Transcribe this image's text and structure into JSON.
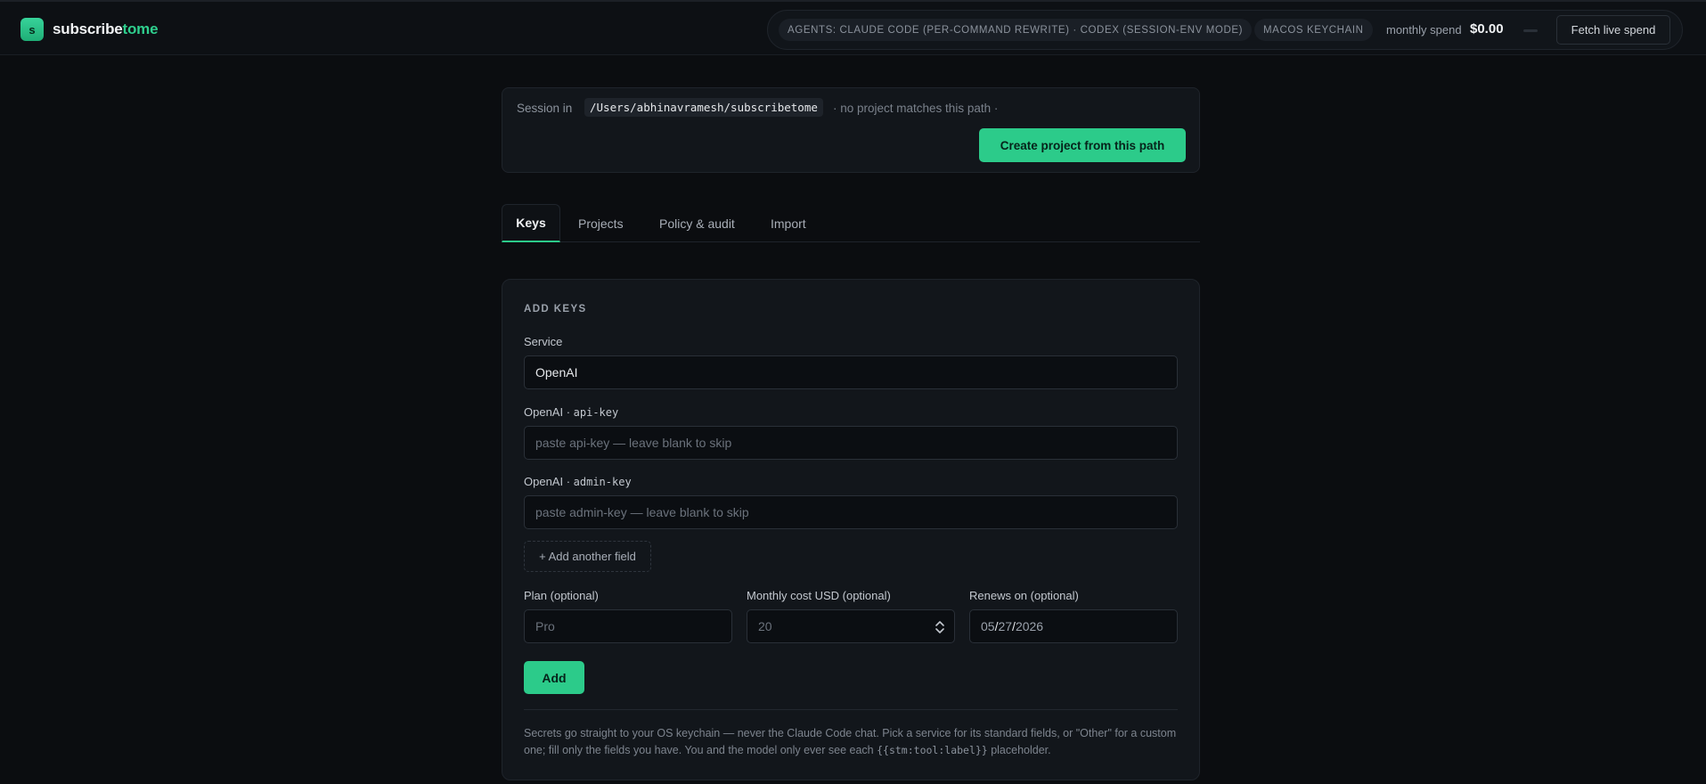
{
  "header": {
    "logo_letter": "s",
    "brand_main": "subscribe",
    "brand_accent": "tome",
    "agents_chip": "AGENTS: CLAUDE CODE (PER-COMMAND REWRITE) · CODEX (SESSION-ENV MODE)",
    "keychain_chip": "MACOS KEYCHAIN",
    "spend_label": "monthly spend",
    "spend_value": "$0.00",
    "fetch_button": "Fetch live spend"
  },
  "session": {
    "label": "Session in",
    "path": "/Users/abhinavramesh/subscribetome",
    "note": "· no project matches this path ·",
    "create_button": "Create project from this path"
  },
  "tabs": [
    {
      "label": "Keys",
      "active": true
    },
    {
      "label": "Projects",
      "active": false
    },
    {
      "label": "Policy & audit",
      "active": false
    },
    {
      "label": "Import",
      "active": false
    }
  ],
  "add_keys": {
    "title": "ADD KEYS",
    "service_label": "Service",
    "service_value": "OpenAI",
    "api_key_label_prefix": "OpenAI · ",
    "api_key_label_code": "api-key",
    "api_key_placeholder": "paste api-key — leave blank to skip",
    "admin_key_label_prefix": "OpenAI · ",
    "admin_key_label_code": "admin-key",
    "admin_key_placeholder": "paste admin-key — leave blank to skip",
    "add_field_button": "+ Add another field",
    "plan_label": "Plan (optional)",
    "plan_placeholder": "Pro",
    "cost_label": "Monthly cost USD (optional)",
    "cost_placeholder": "20",
    "renews_label": "Renews on (optional)",
    "renews_month": "05",
    "renews_day": "27",
    "renews_year": "2026",
    "date_separator": "/",
    "add_button": "Add",
    "footnote_text": "Secrets go straight to your OS keychain — never the Claude Code chat. Pick a service for its standard fields, or \"Other\" for a custom one; fill only the fields you have. You and the model only ever see each ",
    "footnote_code": "{{stm:tool:label}}",
    "footnote_end": " placeholder."
  },
  "colors": {
    "accent": "#2ccb8a",
    "background": "#0b0d10",
    "card": "#12161b"
  },
  "icons": [
    "stepper-icon"
  ]
}
